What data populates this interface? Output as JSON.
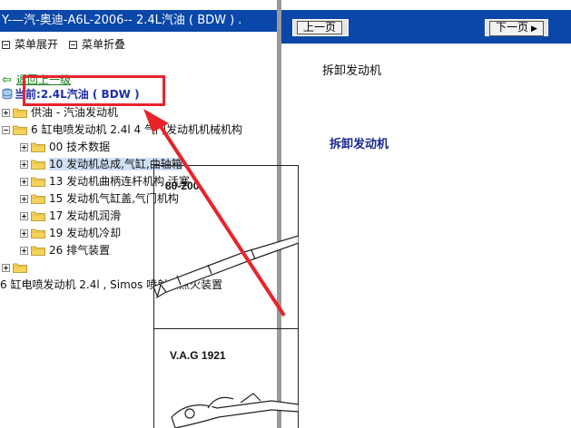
{
  "left": {
    "title": "Y-—汽-奥迪-A6L-2006-- 2.4L汽油 ( BDW ) .",
    "menu_expand": "菜单展开",
    "menu_collapse": "菜单折叠",
    "back_link": "返回上一级",
    "current_prefix": "当前:",
    "current_value": "2.4L汽油 ( BDW )",
    "tree": [
      {
        "label": "供油 - 汽油发动机",
        "toggle": "plus",
        "level": 0
      },
      {
        "label": "6 缸电喷发动机 2.4l 4 气门发动机机械机构",
        "toggle": "minus",
        "level": 0
      },
      {
        "label": "00 技术数据",
        "toggle": "plus",
        "level": 1
      },
      {
        "label": "10 发动机总成,气缸,曲轴箱",
        "toggle": "plus",
        "level": 1,
        "selected": true
      },
      {
        "label": "13 发动机曲柄连杆机构,活塞",
        "toggle": "plus",
        "level": 1
      },
      {
        "label": "15 发动机气缸盖,气门机构",
        "toggle": "plus",
        "level": 1
      },
      {
        "label": "17 发动机润滑",
        "toggle": "plus",
        "level": 1
      },
      {
        "label": "19 发动机冷却",
        "toggle": "plus",
        "level": 1
      },
      {
        "label": "26 排气装置",
        "toggle": "plus",
        "level": 1
      },
      {
        "label": "",
        "toggle": "plus",
        "level": 0
      },
      {
        "label": "6 缸电喷发动机 2.4l , Simos 喷射和点火装置",
        "toggle": "none",
        "level": -1
      }
    ]
  },
  "right": {
    "prev_button": "上一页",
    "next_button": "下一页",
    "page_heading": "拆卸发动机",
    "section_title": "拆卸发动机",
    "tool1": "80-200",
    "tool2": "V.A.G 1921"
  },
  "colors": {
    "title_bar": "#0a47a8",
    "annotation": "#e8242a",
    "selected_row": "#cfe0f3",
    "section_title": "#1a2a90"
  }
}
